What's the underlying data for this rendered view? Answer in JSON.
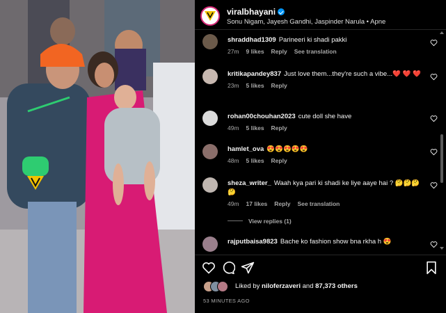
{
  "header": {
    "username": "viralbhayani",
    "subtitle": "Sonu Nigam, Jayesh Gandhi, Jaspinder Narula • Apne"
  },
  "comments": [
    {
      "user": "shraddhad1309",
      "text": "Parineeri ki shadi pakki",
      "time": "27m",
      "likes": "9 likes",
      "reply": "Reply",
      "translate": "See translation",
      "avatar_color": "#6b5a4a"
    },
    {
      "user": "kritikapandey837",
      "text": "Just love them...they're such a vibe...❤️ ❤️ ❤️",
      "time": "23m",
      "likes": "5 likes",
      "reply": "Reply",
      "translate": "",
      "avatar_color": "#c7b8b0"
    },
    {
      "user": "rohan00chouhan2023",
      "text": "cute doll she have",
      "time": "49m",
      "likes": "5 likes",
      "reply": "Reply",
      "translate": "",
      "avatar_color": "#dbdbdb"
    },
    {
      "user": "hamlet_ova",
      "text": "😍😍😍😍😍",
      "time": "48m",
      "likes": "5 likes",
      "reply": "Reply",
      "translate": "",
      "avatar_color": "#8a6e6a"
    },
    {
      "user": "sheza_writer_",
      "text": "Waah kya pari ki shadi ke liye aaye hai ? 🤔🤔🤔 🤔",
      "time": "49m",
      "likes": "17 likes",
      "reply": "Reply",
      "translate": "See translation",
      "avatar_color": "#bfb6b0"
    },
    {
      "user": "rajputbaisa9823",
      "text": "Bache ko fashion show bna rkha h 😍",
      "time": "",
      "likes": "",
      "reply": "",
      "translate": "",
      "avatar_color": "#9a7f8c"
    }
  ],
  "view_replies": "View replies (1)",
  "liked_by": {
    "prefix": "Liked by",
    "user": "niloferzaveri",
    "middle": "and",
    "count": "87,373 others"
  },
  "timestamp": "53 MINUTES AGO",
  "icons": {
    "like": "heart-icon",
    "comment": "comment-icon",
    "share": "send-icon",
    "save": "bookmark-icon"
  },
  "colors": {
    "background": "#000000",
    "verified": "#0095f6",
    "meta": "#a8a8a8",
    "dress": "#d81b74",
    "cap": "#f26522"
  }
}
